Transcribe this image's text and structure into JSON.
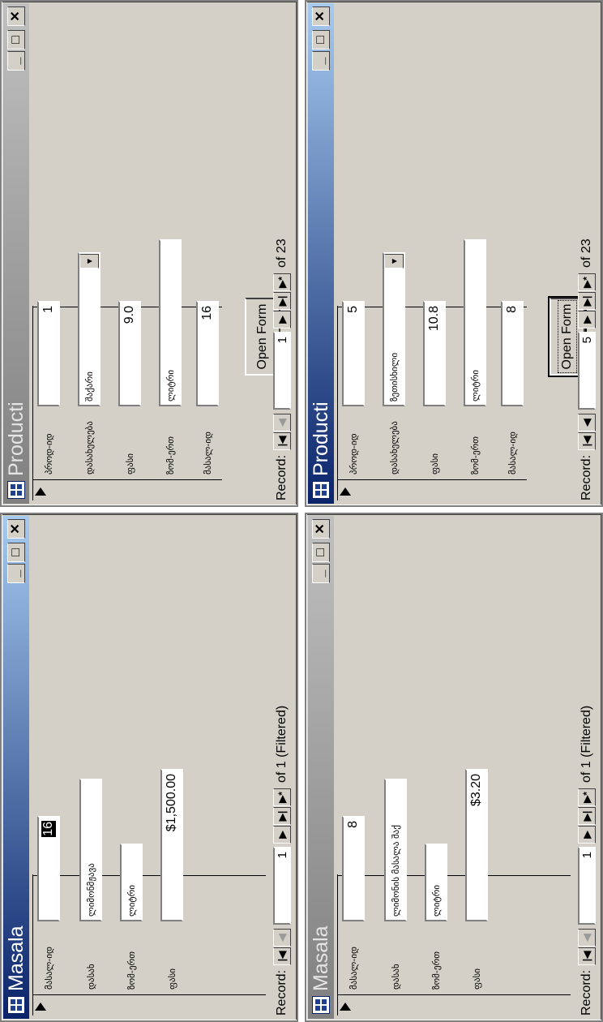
{
  "windows": [
    {
      "title": "Producti",
      "active": false,
      "fields": [
        {
          "label": "პროდ-იდ",
          "value": "1"
        },
        {
          "label": "დასახელება",
          "value": "შაქარი"
        },
        {
          "label": "ფასი",
          "value": "9.0"
        },
        {
          "label": "ზომ-ერთ",
          "value": "ლიტრი"
        },
        {
          "label": "მასალ-იდ",
          "value": "16"
        }
      ],
      "button": "Open Form",
      "nav": {
        "label": "Record:",
        "current": "1",
        "of_text": "of  23"
      }
    },
    {
      "title": "Producti",
      "active": true,
      "fields": [
        {
          "label": "პროდ-იდ",
          "value": "5"
        },
        {
          "label": "დასახელება",
          "value": "ზეთისხილი"
        },
        {
          "label": "ფასი",
          "value": "10.8"
        },
        {
          "label": "ზომ-ერთ",
          "value": "ლიტრი"
        },
        {
          "label": "მასალ-იდ",
          "value": "8"
        }
      ],
      "button": "Open Form",
      "nav": {
        "label": "Record:",
        "current": "5",
        "of_text": "of  23"
      }
    },
    {
      "title": "Masala",
      "active": true,
      "fields": [
        {
          "label": "მასალ-იდ",
          "value": "16"
        },
        {
          "label": "დასახ",
          "value": "ლიმონმჟავა"
        },
        {
          "label": "ზომ-ერთ",
          "value": "ლიტრი"
        },
        {
          "label": "ფასი",
          "value": "$1,500.00"
        }
      ],
      "nav": {
        "label": "Record:",
        "current": "1",
        "of_text": "of  1 (Filtered)"
      }
    },
    {
      "title": "Masala",
      "active": false,
      "fields": [
        {
          "label": "მასალ-იდ",
          "value": "8"
        },
        {
          "label": "დასახ",
          "value": "ლიმონის მასალა შაქ"
        },
        {
          "label": "ზომ-ერთ",
          "value": "ლიტრი"
        },
        {
          "label": "ფასი",
          "value": "$3.20"
        }
      ],
      "nav": {
        "label": "Record:",
        "current": "1",
        "of_text": "of  1 (Filtered)"
      }
    }
  ],
  "icons": {
    "minimize": "minimize-icon",
    "maximize": "maximize-icon",
    "close": "close-icon",
    "nav_first": "first-record-icon",
    "nav_prev": "previous-record-icon",
    "nav_next": "next-record-icon",
    "nav_last": "last-record-icon",
    "nav_new": "new-record-icon"
  }
}
